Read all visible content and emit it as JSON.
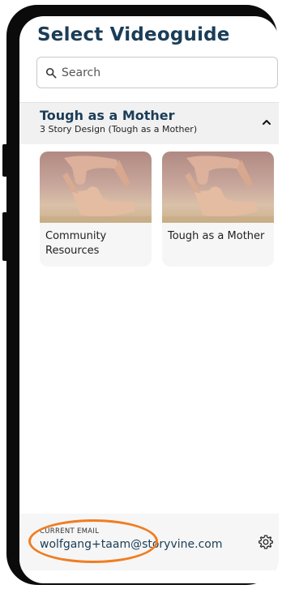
{
  "page": {
    "title": "Select Videoguide"
  },
  "search": {
    "placeholder": "Search"
  },
  "group": {
    "title": "Tough as a Mother",
    "subtitle": "3 Story Design (Tough as a Mother)"
  },
  "cards": [
    {
      "label": "Community Resources"
    },
    {
      "label": "Tough as a Mother"
    }
  ],
  "footer": {
    "email_label": "CURRENT EMAIL",
    "email": "wolfgang+taam@storyvine.com"
  },
  "colors": {
    "heading": "#1b3d57",
    "highlight": "#f07d22"
  }
}
